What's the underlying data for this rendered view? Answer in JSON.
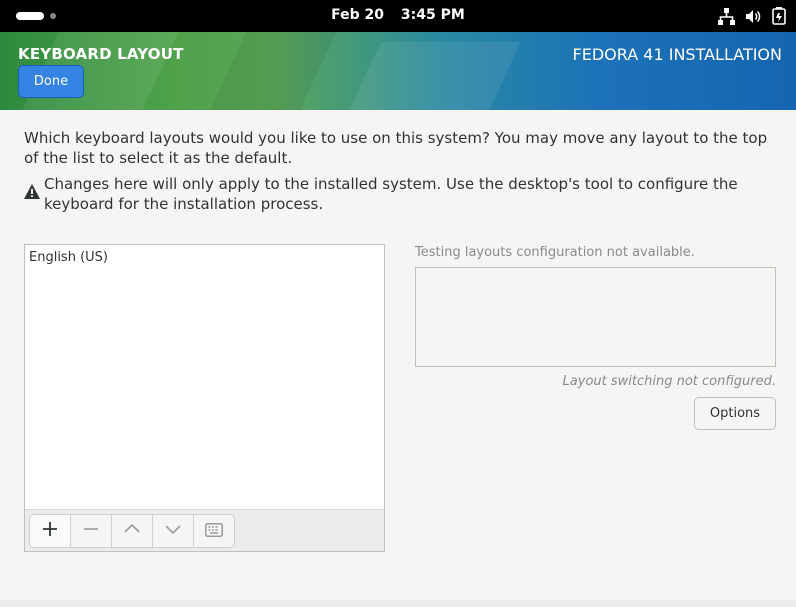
{
  "topbar": {
    "date": "Feb 20",
    "time": "3:45 PM",
    "tray_icons": [
      "network-icon",
      "volume-icon",
      "battery-icon"
    ]
  },
  "header": {
    "screen_title": "KEYBOARD LAYOUT",
    "product_title": "FEDORA 41 INSTALLATION",
    "done_label": "Done"
  },
  "content": {
    "intro": "Which keyboard layouts would you like to use on this system?  You may move any layout to the top of the list to select it as the default.",
    "warning": "Changes here will only apply to the installed system. Use the desktop's tool to configure the keyboard for the installation process.",
    "layouts": [
      "English (US)"
    ],
    "toolbar_icons": [
      "add-icon",
      "remove-icon",
      "move-up-icon",
      "move-down-icon",
      "keyboard-preview-icon"
    ],
    "test_label": "Testing layouts configuration not available.",
    "switching_note": "Layout switching not configured.",
    "options_label": "Options"
  },
  "colors": {
    "accent": "#3584e4",
    "topbar": "#000000",
    "background": "#f6f5f4"
  }
}
